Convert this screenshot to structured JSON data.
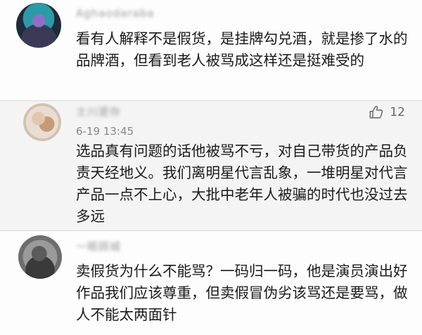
{
  "comments": [
    {
      "username": "Aghaodaraba",
      "text": "看有人解释不是假货，是挂牌勾兑酒，就是掺了水的品牌酒，但看到老人被骂成这样还是挺难受的"
    },
    {
      "username": "士川是你",
      "time": "6-19 13:45",
      "likes": "12",
      "like_icon": "thumbs-up-icon",
      "text": "选品真有问题的话他被骂不亏，对自己带货的产品负责天经地义。我们离明星代言乱象，一堆明星对代言产品一点不上心，大批中老年人被骗的时代也没过去多远"
    },
    {
      "username": "一眼顾城",
      "text": "卖假货为什么不能骂？一码归一码，他是演员演出好作品我们应该尊重，但卖假冒伪劣该骂还是要骂，做人不能太两面针"
    }
  ]
}
